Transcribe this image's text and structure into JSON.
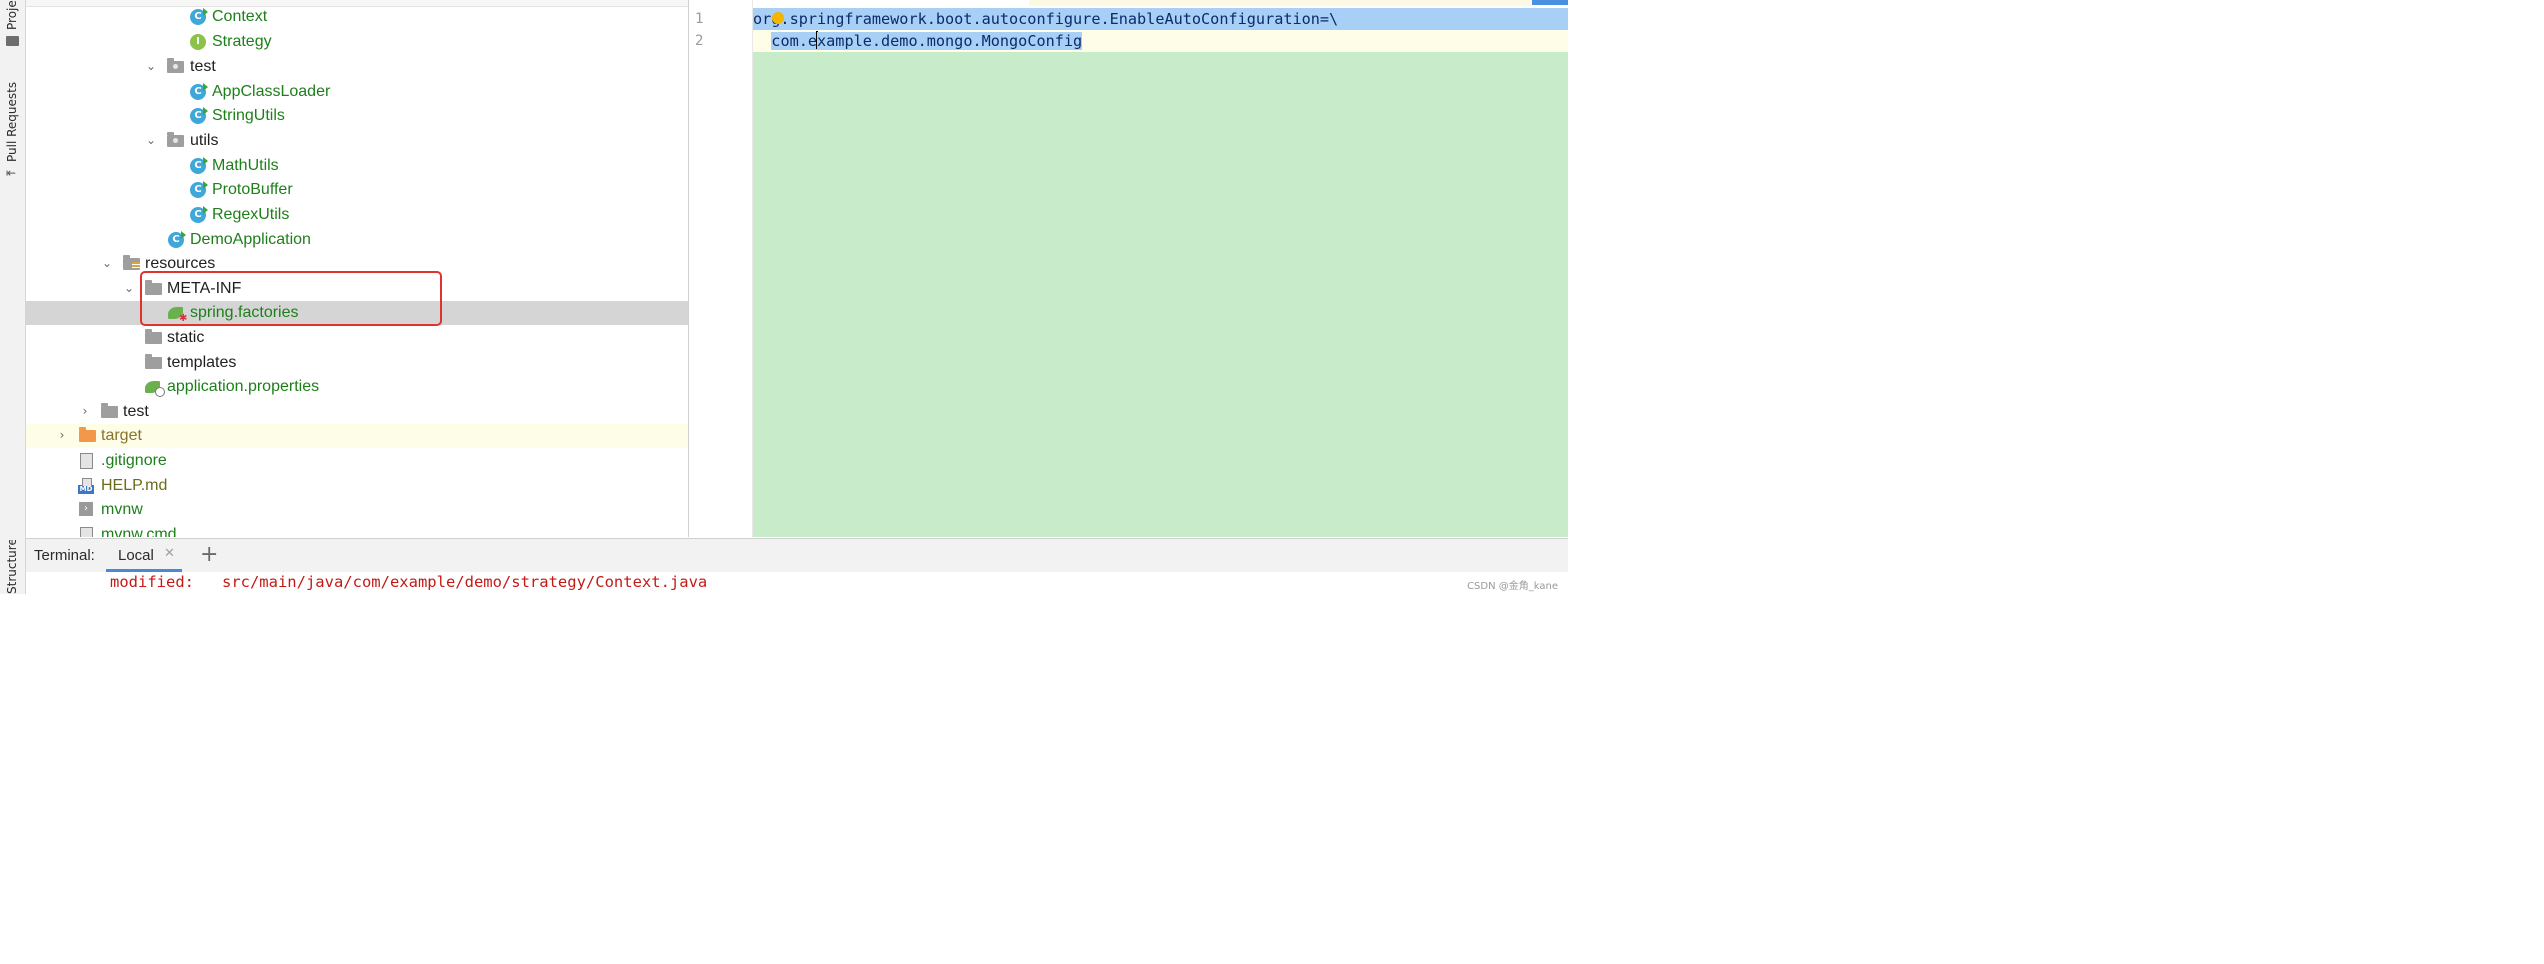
{
  "tool_strip": {
    "project_label": "Project",
    "pull_requests_label": "Pull Requests",
    "structure_label": "Structure"
  },
  "tree": {
    "items": [
      {
        "label": "Context",
        "icon": "class-icon",
        "icon_letter": "C"
      },
      {
        "label": "Strategy",
        "icon": "interface-icon",
        "icon_letter": "I"
      },
      {
        "label": "test",
        "icon": "package-folder-icon"
      },
      {
        "label": "AppClassLoader",
        "icon": "class-icon",
        "icon_letter": "C"
      },
      {
        "label": "StringUtils",
        "icon": "class-icon",
        "icon_letter": "C"
      },
      {
        "label": "utils",
        "icon": "package-folder-icon"
      },
      {
        "label": "MathUtils",
        "icon": "class-icon",
        "icon_letter": "C"
      },
      {
        "label": "ProtoBuffer",
        "icon": "class-icon",
        "icon_letter": "C"
      },
      {
        "label": "RegexUtils",
        "icon": "class-icon",
        "icon_letter": "C"
      },
      {
        "label": "DemoApplication",
        "icon": "spring-boot-class-icon",
        "icon_letter": "C"
      },
      {
        "label": "resources",
        "icon": "resources-folder-icon"
      },
      {
        "label": "META-INF",
        "icon": "folder-icon"
      },
      {
        "label": "spring.factories",
        "icon": "spring-factories-icon"
      },
      {
        "label": "static",
        "icon": "folder-icon"
      },
      {
        "label": "templates",
        "icon": "folder-icon"
      },
      {
        "label": "application.properties",
        "icon": "spring-properties-icon"
      },
      {
        "label": "test",
        "icon": "folder-icon"
      },
      {
        "label": "target",
        "icon": "excluded-folder-icon"
      },
      {
        "label": ".gitignore",
        "icon": "gitignore-file-icon"
      },
      {
        "label": "HELP.md",
        "icon": "markdown-file-icon",
        "icon_text": "MD"
      },
      {
        "label": "mvnw",
        "icon": "shell-script-icon"
      },
      {
        "label": "mvnw.cmd",
        "icon": "text-file-icon"
      }
    ]
  },
  "editor": {
    "line_numbers": [
      "1",
      "2"
    ],
    "line1": "org.springframework.boot.autoconfigure.EnableAutoConfiguration=\\",
    "line2_indent": "  ",
    "line2_before_caret": "com.e",
    "line2_after_caret": "xample.demo.mongo.MongoConfig"
  },
  "terminal": {
    "title": "Terminal:",
    "tab_label": "Local",
    "tab_close": "✕",
    "add_label": "+",
    "line": "modified:   src/main/java/com/example/demo/strategy/Context.java"
  },
  "watermark": "CSDN @金角_kane",
  "colors": {
    "selection": "#a8cff5",
    "editor_background": "#c8ecca",
    "highlight_box": "#e0322e",
    "terminal_text": "#c41a16"
  }
}
